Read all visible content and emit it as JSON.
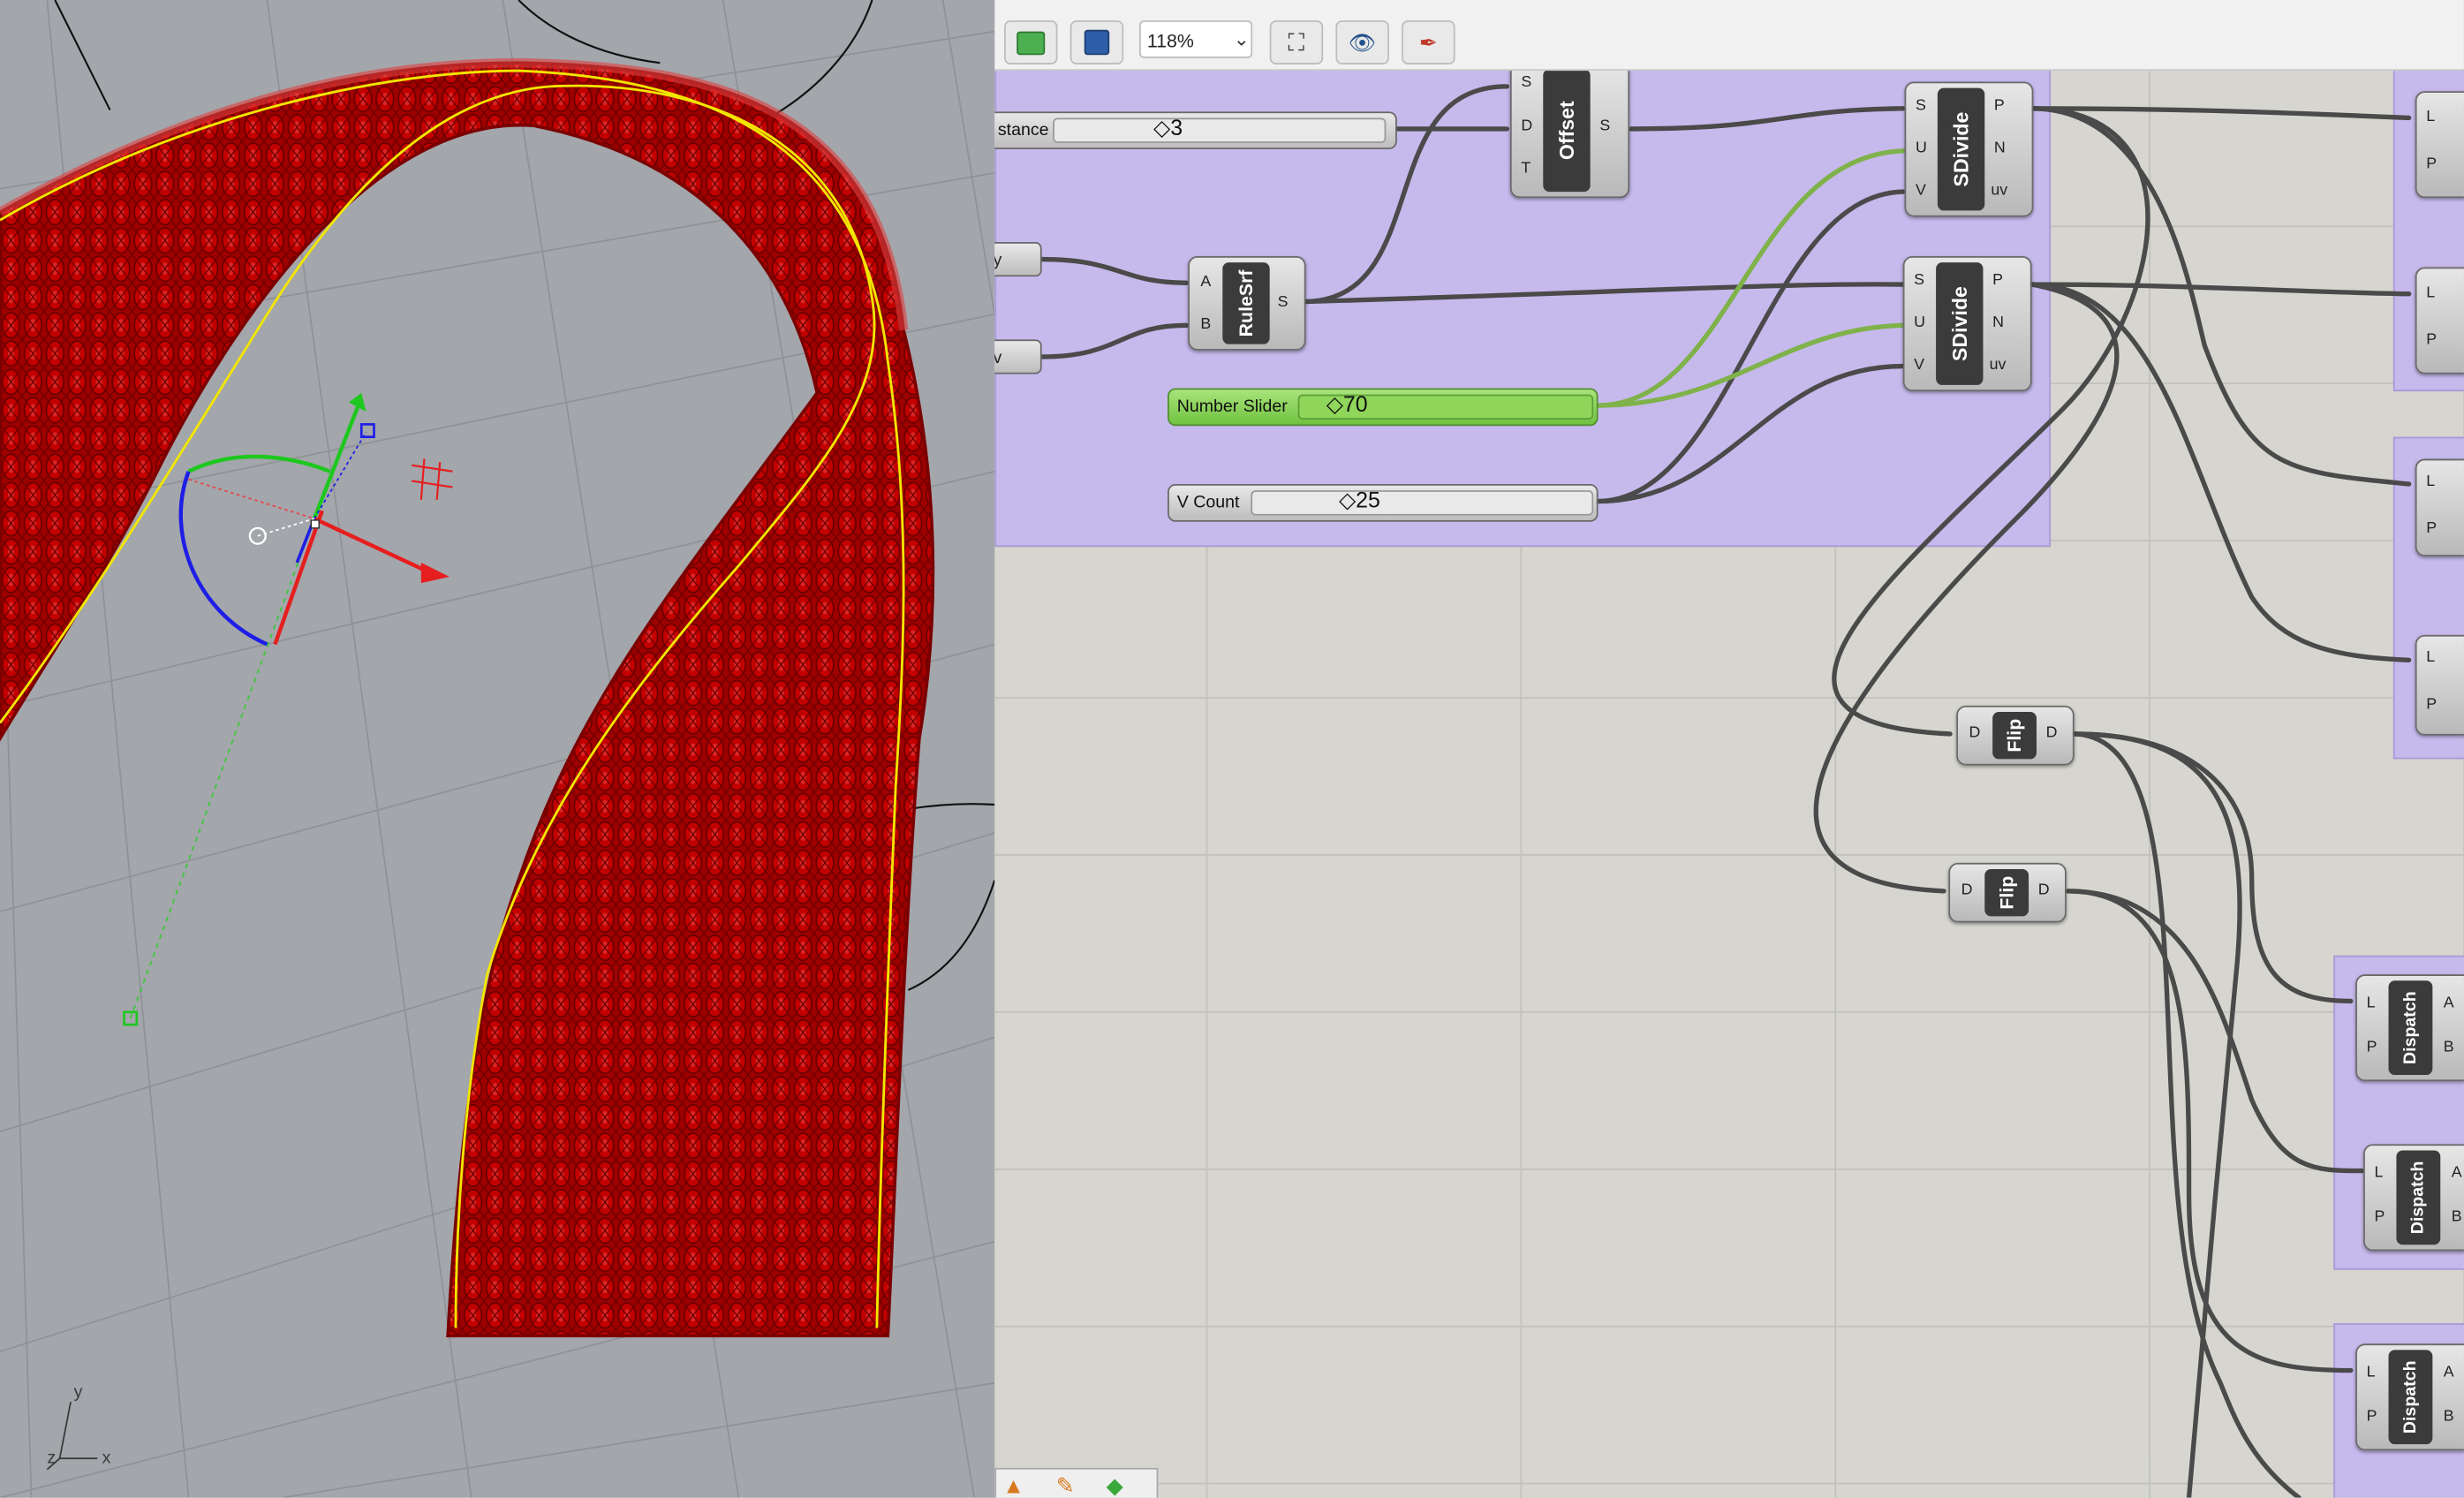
{
  "toolbar": {
    "zoom": "118%",
    "icons": [
      "open-file-icon",
      "save-icon",
      "zoom-extents-icon",
      "preview-eye-icon",
      "sketch-pen-icon"
    ]
  },
  "viewport": {
    "axis_labels": {
      "y": "y",
      "x": "x",
      "z": "z"
    }
  },
  "canvas": {
    "sliders": [
      {
        "name": "Distance",
        "label": "stance",
        "value": "3"
      },
      {
        "name": "Number Slider",
        "label": "Number Slider",
        "value": "70"
      },
      {
        "name": "V Count",
        "label": "V Count",
        "value": "25"
      }
    ],
    "components": {
      "offset": {
        "title": "Offset",
        "inputs": [
          "S",
          "D",
          "T"
        ],
        "outputs": [
          "S"
        ]
      },
      "rulesrf": {
        "title": "RuleSrf",
        "inputs": [
          "A",
          "B"
        ],
        "outputs": [
          "S"
        ]
      },
      "sdivide_1": {
        "title": "SDivide",
        "inputs": [
          "S",
          "U",
          "V"
        ],
        "outputs": [
          "P",
          "N",
          "uv"
        ]
      },
      "sdivide_2": {
        "title": "SDivide",
        "inputs": [
          "S",
          "U",
          "V"
        ],
        "outputs": [
          "P",
          "N",
          "uv"
        ]
      },
      "flip_1": {
        "title": "Flip",
        "inputs": [
          "D"
        ],
        "outputs": [
          "D"
        ]
      },
      "flip_2": {
        "title": "Flip",
        "inputs": [
          "D"
        ],
        "outputs": [
          "D"
        ]
      },
      "dispatch_1": {
        "title": "Dispatch",
        "inputs": [
          "L",
          "P"
        ],
        "outputs": [
          "A",
          "B"
        ]
      },
      "dispatch_2": {
        "title": "Dispatch",
        "inputs": [
          "L",
          "P"
        ],
        "outputs": [
          "A",
          "B"
        ]
      },
      "dispatch_3": {
        "title": "Dispatch",
        "inputs": [
          "L",
          "P"
        ],
        "outputs": [
          "A",
          "B"
        ]
      }
    },
    "stubs": {
      "stub1": "y",
      "stub2": "v"
    },
    "right_ports": [
      {
        "top": "L",
        "bottom": "P"
      },
      {
        "top": "L",
        "bottom": "P"
      },
      {
        "top": "L",
        "bottom": "P"
      },
      {
        "top": "L",
        "bottom": "P"
      }
    ]
  },
  "colors": {
    "group_fill": "#c6b9ec",
    "canvas_bg": "#d6d5cf",
    "viewport_bg": "#a3a6ab",
    "mesh_red": "#c00000",
    "curve_yellow": "#f2e600",
    "slider_green": "#7ed14a"
  }
}
